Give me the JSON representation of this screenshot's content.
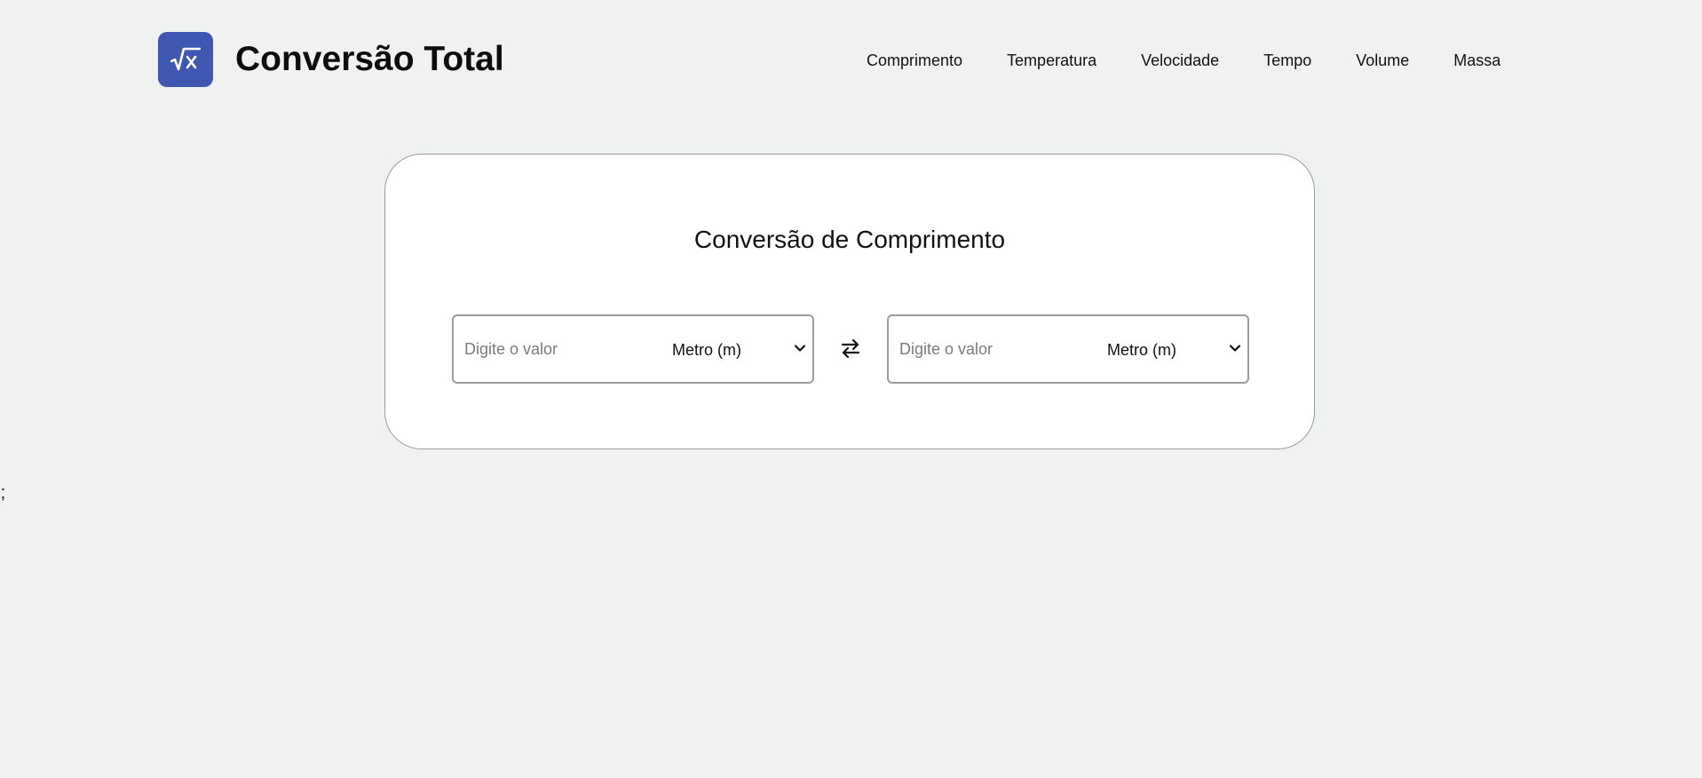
{
  "header": {
    "logo_icon": "square-root-x-icon",
    "title": "Conversão Total"
  },
  "nav": {
    "items": [
      {
        "label": "Comprimento"
      },
      {
        "label": "Temperatura"
      },
      {
        "label": "Velocidade"
      },
      {
        "label": "Tempo"
      },
      {
        "label": "Volume"
      },
      {
        "label": "Massa"
      }
    ]
  },
  "converter": {
    "title": "Conversão de Comprimento",
    "from": {
      "placeholder": "Digite o valor",
      "value": "",
      "unit": "Metro (m)"
    },
    "to": {
      "placeholder": "Digite o valor",
      "value": "",
      "unit": "Metro (m)"
    },
    "swap_icon": "swap-arrows-icon"
  },
  "stray_text": ");",
  "colors": {
    "background": "#f0f1f1",
    "accent": "#3f57b0",
    "card": "#ffffff",
    "border": "#9c9c9c"
  }
}
